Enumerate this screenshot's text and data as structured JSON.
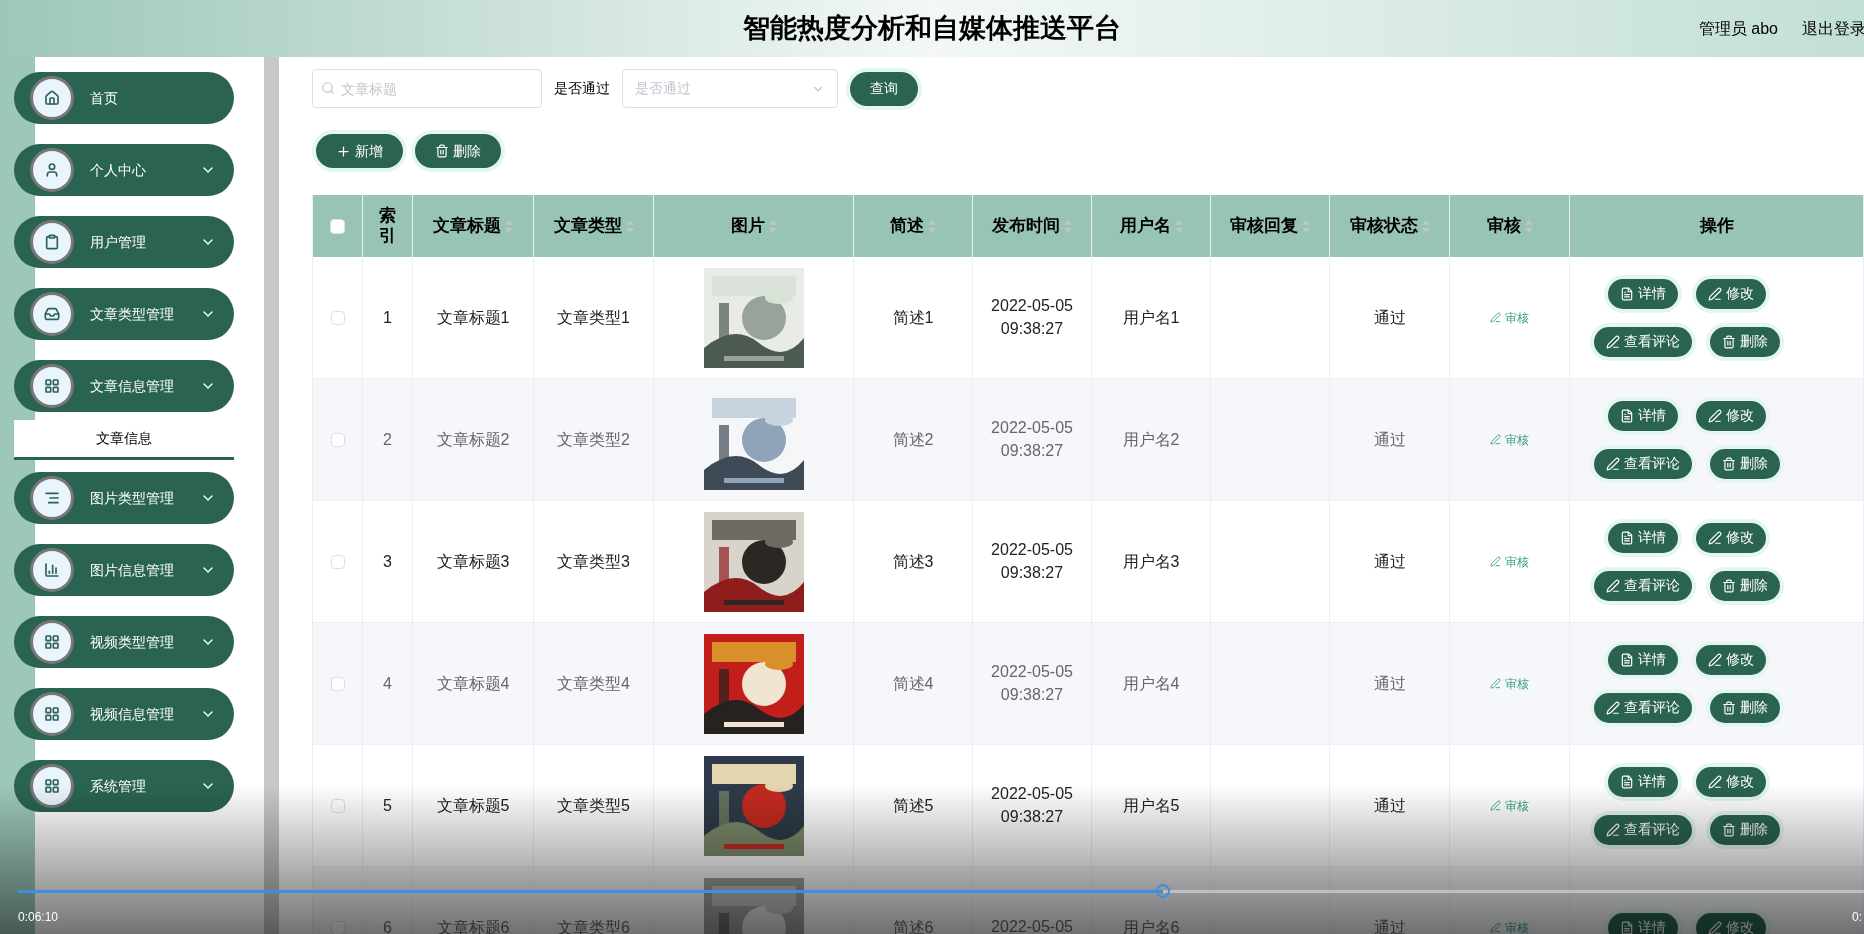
{
  "header": {
    "title": "智能热度分析和自媒体推送平台",
    "user_label": "管理员 abo",
    "logout": "退出登录"
  },
  "sidebar": {
    "items": [
      {
        "kind": "link",
        "label": "首页"
      },
      {
        "kind": "menu",
        "label": "个人中心"
      },
      {
        "kind": "menu",
        "label": "用户管理"
      },
      {
        "kind": "menu",
        "label": "文章类型管理"
      },
      {
        "kind": "menu",
        "label": "文章信息管理",
        "children": [
          {
            "label": "文章信息",
            "selected": true
          }
        ]
      },
      {
        "kind": "menu",
        "label": "图片类型管理"
      },
      {
        "kind": "menu",
        "label": "图片信息管理"
      },
      {
        "kind": "menu",
        "label": "视频类型管理"
      },
      {
        "kind": "menu",
        "label": "视频信息管理"
      },
      {
        "kind": "menu",
        "label": "系统管理"
      }
    ]
  },
  "search": {
    "title_placeholder": "文章标题",
    "pass_label": "是否通过",
    "pass_placeholder": "是否通过",
    "query_button": "查询"
  },
  "actions": {
    "add": "新增",
    "delete": "删除"
  },
  "table": {
    "select_all_checked": false,
    "columns": [
      {
        "label": "索引",
        "sortable": false
      },
      {
        "label": "文章标题",
        "sortable": true
      },
      {
        "label": "文章类型",
        "sortable": true
      },
      {
        "label": "图片",
        "sortable": true
      },
      {
        "label": "简述",
        "sortable": true
      },
      {
        "label": "发布时间",
        "sortable": true
      },
      {
        "label": "用户名",
        "sortable": true
      },
      {
        "label": "审核回复",
        "sortable": true
      },
      {
        "label": "审核状态",
        "sortable": true
      },
      {
        "label": "审核",
        "sortable": true
      },
      {
        "label": "操作",
        "sortable": false
      }
    ],
    "rows": [
      {
        "checked": false,
        "index": "1",
        "title": "文章标题1",
        "type": "文章类型1",
        "summary": "简述1",
        "time": "2022-05-05 09:38:27",
        "user": "用户名1",
        "status": "通过",
        "audit": "审核",
        "buttons": [
          "详情",
          "修改",
          "查看评论",
          "删除"
        ]
      },
      {
        "checked": false,
        "index": "2",
        "title": "文章标题2",
        "type": "文章类型2",
        "summary": "简述2",
        "time": "2022-05-05 09:38:27",
        "user": "用户名2",
        "status": "通过",
        "audit": "审核",
        "buttons": [
          "详情",
          "修改",
          "查看评论",
          "删除"
        ]
      },
      {
        "checked": false,
        "index": "3",
        "title": "文章标题3",
        "type": "文章类型3",
        "summary": "简述3",
        "time": "2022-05-05 09:38:27",
        "user": "用户名3",
        "status": "通过",
        "audit": "审核",
        "buttons": [
          "详情",
          "修改",
          "查看评论",
          "删除"
        ]
      },
      {
        "checked": false,
        "index": "4",
        "title": "文章标题4",
        "type": "文章类型4",
        "summary": "简述4",
        "time": "2022-05-05 09:38:27",
        "user": "用户名4",
        "status": "通过",
        "audit": "审核",
        "buttons": [
          "详情",
          "修改",
          "查看评论",
          "删除"
        ]
      },
      {
        "checked": false,
        "index": "5",
        "title": "文章标题5",
        "type": "文章类型5",
        "summary": "简述5",
        "time": "2022-05-05 09:38:27",
        "user": "用户名5",
        "status": "通过",
        "audit": "审核",
        "buttons": [
          "详情",
          "修改",
          "查看评论",
          "删除"
        ]
      },
      {
        "checked": false,
        "index": "6",
        "title": "文章标题6",
        "type": "文章类型6",
        "summary": "简述6",
        "time": "2022-05-05",
        "user": "用户名6",
        "status": "通过",
        "audit": "审核",
        "buttons": [
          "详情",
          "修改"
        ]
      }
    ]
  },
  "player": {
    "current_time": "0:06:10",
    "total_time": "0:",
    "level": 0.62
  }
}
